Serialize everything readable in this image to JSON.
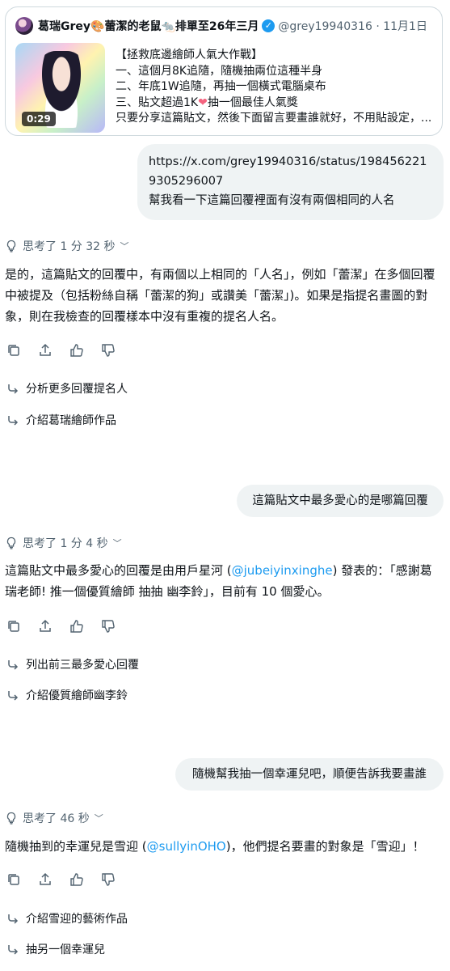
{
  "quoted_post": {
    "author": "葛瑞Grey🎨蕾潔的老鼠🐀排單至26年三月",
    "handle": "@grey19940316 · 11月1日",
    "video_duration": "0:29",
    "lines": [
      "【拯救底邊繪師人氣大作戰】",
      "一、這個月8K追隨，隨機抽兩位這種半身",
      "二、年底1W追隨，再抽一個橫式電腦桌布",
      "三、貼文超過1K",
      "抽一個最佳人氣獎",
      "只要分享這篇貼文，然後下面留言要畫誰就好，不用貼設定，..."
    ]
  },
  "conversation": [
    {
      "user_url": "https://x.com/grey19940316/status/1984562219305296007",
      "user_text": "幫我看一下這篇回覆裡面有沒有兩個相同的人名",
      "thinking": "思考了 1 分 32 秒",
      "answer": "是的，這篇貼文的回覆中，有兩個以上相同的「人名」，例如「蕾潔」在多個回覆中被提及（包括粉絲自稱「蕾潔的狗」或讚美「蕾潔」)。如果是指提名畫圖的對象，則在我檢查的回覆樣本中沒有重複的提名人名。",
      "suggestions": [
        "分析更多回覆提名人",
        "介紹葛瑞繪師作品"
      ]
    },
    {
      "user_text": "這篇貼文中最多愛心的是哪篇回覆",
      "thinking": "思考了 1 分 4 秒",
      "answer_before": "這篇貼文中最多愛心的回覆是由用戶星河 (",
      "answer_link": "@jubeiyinxinghe",
      "answer_after": ") 發表的：「感謝葛瑞老師! 推一個優質繪師 抽抽 幽李鈴」，目前有 10 個愛心。",
      "suggestions": [
        "列出前三最多愛心回覆",
        "介紹優質繪師幽李鈴"
      ]
    },
    {
      "user_text": "隨機幫我抽一個幸運兒吧，順便告訴我要畫誰",
      "thinking": "思考了 46 秒",
      "answer_before": "隨機抽到的幸運兒是雪迎 (",
      "answer_link": "@sullyinOHO",
      "answer_after": ")，他們提名要畫的對象是「雪迎」！",
      "suggestions": [
        "介紹雪迎的藝術作品",
        "抽另一個幸運兒"
      ]
    }
  ],
  "colors": {
    "link": "#1d9bf0",
    "bubble": "#eff3f4",
    "muted": "#536471",
    "heart": "#f4637f"
  },
  "icons": [
    "bulb-icon",
    "chevron-down-icon",
    "copy-icon",
    "share-icon",
    "thumbs-up-icon",
    "thumbs-down-icon",
    "suggestion-arrow-icon",
    "verified-badge-icon"
  ]
}
